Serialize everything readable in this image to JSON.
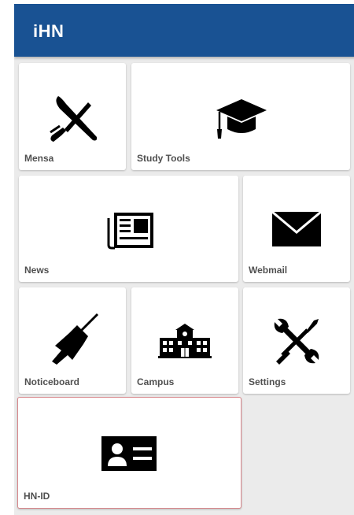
{
  "app": {
    "title": "iHN",
    "accent_color": "#195293",
    "background_color": "#ebebeb"
  },
  "tiles": [
    {
      "label": "Mensa",
      "icon": "fork-knife-icon"
    },
    {
      "label": "Study Tools",
      "icon": "graduation-cap-icon"
    },
    {
      "label": "News",
      "icon": "newspaper-icon"
    },
    {
      "label": "Webmail",
      "icon": "envelope-icon"
    },
    {
      "label": "Noticeboard",
      "icon": "pushpin-icon"
    },
    {
      "label": "Campus",
      "icon": "building-icon"
    },
    {
      "label": "Settings",
      "icon": "wrench-screwdriver-icon"
    },
    {
      "label": "HN-ID",
      "icon": "id-card-icon",
      "selected": true
    }
  ]
}
